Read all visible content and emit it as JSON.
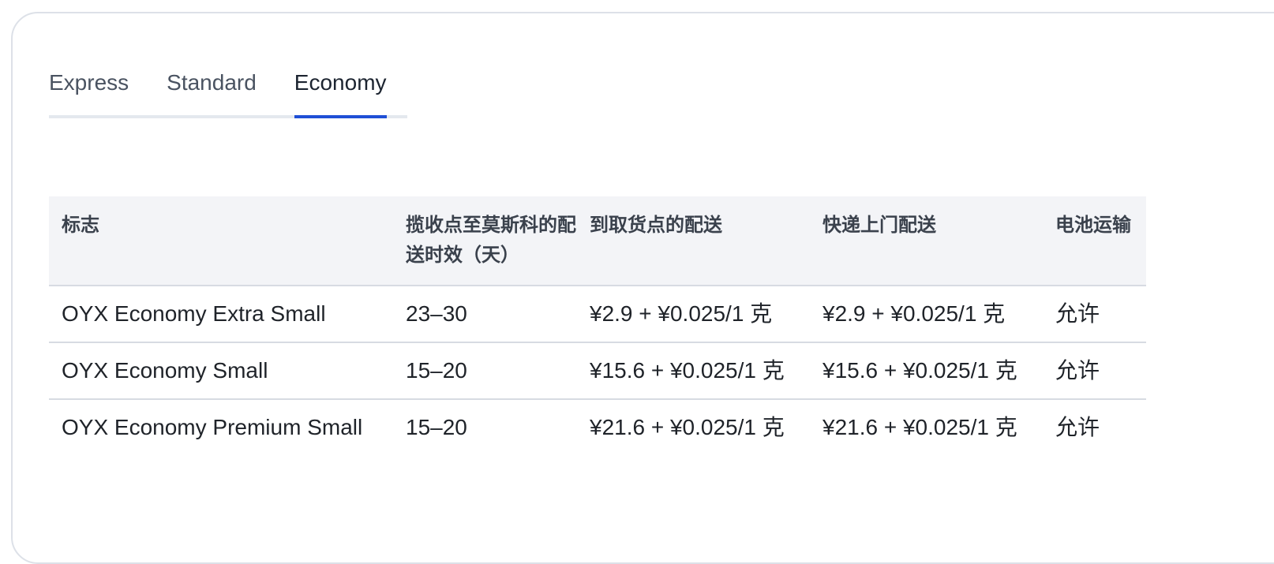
{
  "tabs": [
    {
      "label": "Express",
      "active": false
    },
    {
      "label": "Standard",
      "active": false
    },
    {
      "label": "Economy",
      "active": true
    }
  ],
  "table": {
    "headers": {
      "name": "标志",
      "transit": "揽收点至莫斯科的配送时效（天）",
      "pickup_point": "到取货点的配送",
      "courier": "快递上门配送",
      "battery": "电池运输"
    },
    "rows": [
      {
        "name": "OYX Economy Extra Small",
        "transit": "23–30",
        "pickup_point": "¥2.9 + ¥0.025/1 克",
        "courier": "¥2.9 + ¥0.025/1 克",
        "battery": "允许"
      },
      {
        "name": "OYX Economy Small",
        "transit": "15–20",
        "pickup_point": "¥15.6 + ¥0.025/1 克",
        "courier": "¥15.6 + ¥0.025/1 克",
        "battery": "允许"
      },
      {
        "name": "OYX Economy Premium Small",
        "transit": "15–20",
        "pickup_point": "¥21.6 + ¥0.025/1 克",
        "courier": "¥21.6 + ¥0.025/1 克",
        "battery": "允许"
      }
    ]
  },
  "colors": {
    "active_tab_underline": "#1f4fd6",
    "header_background": "#f3f4f7",
    "border": "#d7dbe2"
  }
}
